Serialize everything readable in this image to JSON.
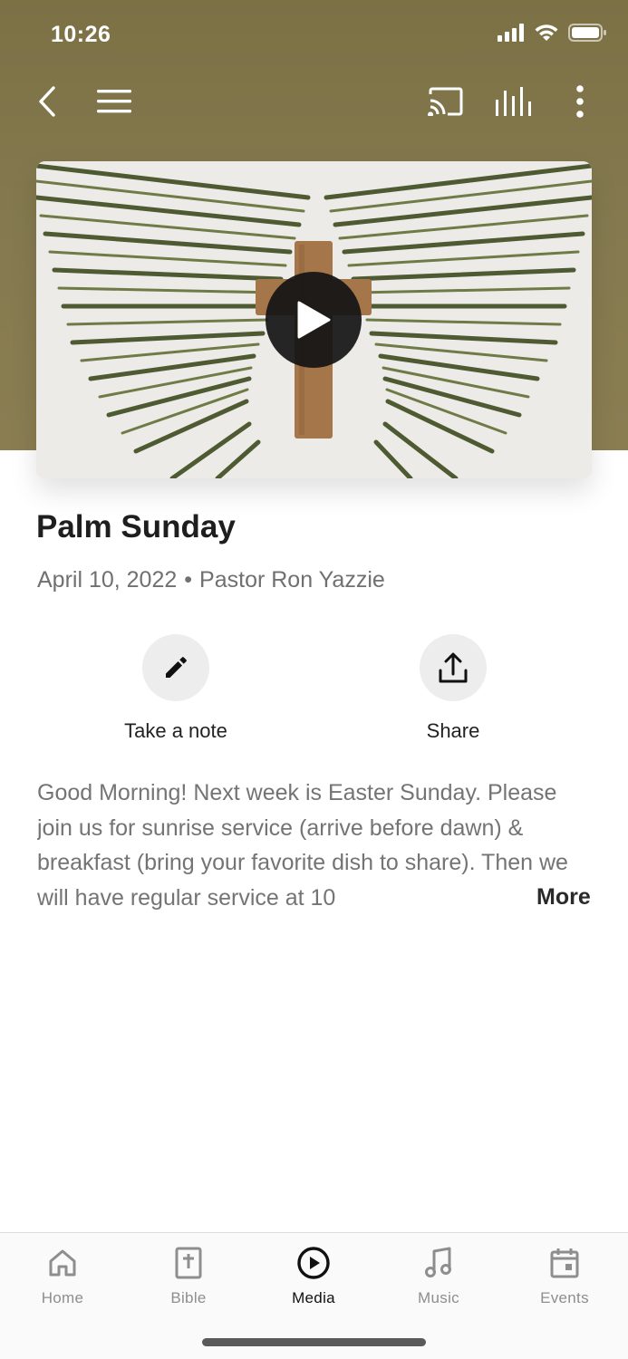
{
  "status_bar": {
    "time": "10:26"
  },
  "toolbar": {
    "back_icon": "chevron-left-icon",
    "menu_icon": "hamburger-menu-icon",
    "cast_icon": "cast-icon",
    "audio_icon": "equalizer-icon",
    "more_icon": "vertical-dots-icon"
  },
  "video": {
    "thumbnail": "palm-branches-with-wooden-cross",
    "play_icon": "play-icon"
  },
  "sermon": {
    "title": "Palm Sunday",
    "date": "April 10, 2022",
    "separator": "•",
    "speaker": "Pastor Ron Yazzie"
  },
  "actions": [
    {
      "label": "Take a note",
      "icon": "pencil-icon"
    },
    {
      "label": "Share",
      "icon": "share-upload-icon"
    }
  ],
  "description": {
    "text": "Good Morning! Next week is Easter Sunday. Please join us for sunrise service (arrive before dawn) & breakfast (bring your favorite dish to share). Then we will have regular service at 10",
    "more_label": "More"
  },
  "tabs": [
    {
      "label": "Home",
      "icon": "home-icon",
      "active": false
    },
    {
      "label": "Bible",
      "icon": "bible-icon",
      "active": false
    },
    {
      "label": "Media",
      "icon": "play-circle-icon",
      "active": true
    },
    {
      "label": "Music",
      "icon": "music-note-icon",
      "active": false
    },
    {
      "label": "Events",
      "icon": "calendar-icon",
      "active": false
    }
  ],
  "colors": {
    "header": "#857a4f",
    "active_tab": "#111111",
    "inactive_tab": "#8e8e8e"
  }
}
